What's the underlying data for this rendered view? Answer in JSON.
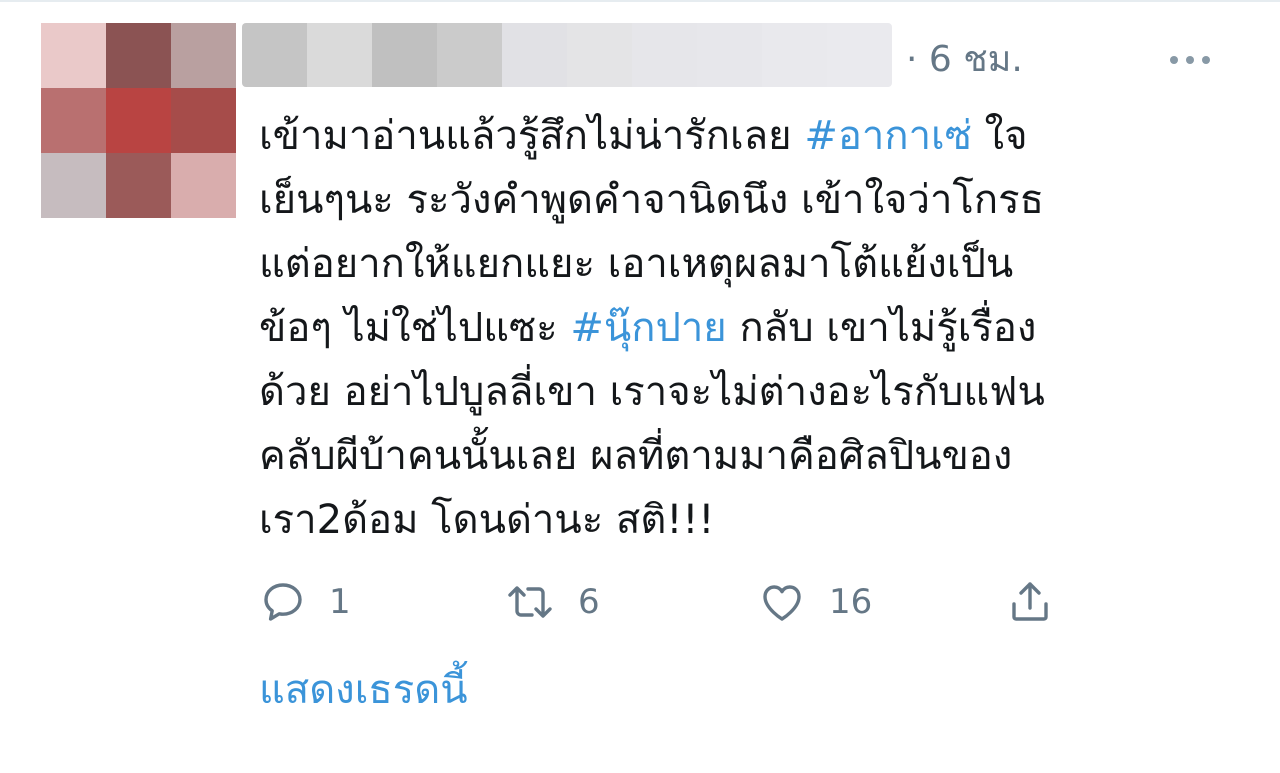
{
  "tweet": {
    "time": "· 6 ชม.",
    "text_lines": [
      [
        {
          "t": "เข้ามาอ่านแล้วรู้สึกไม่น่ารักเลย "
        },
        {
          "t": "#อากาเซ่",
          "h": true
        },
        {
          "t": " ใจ"
        }
      ],
      [
        {
          "t": "เย็นๆนะ ระวังคำพูดคำจานิดนึง เข้าใจว่าโกรธ"
        }
      ],
      [
        {
          "t": "แต่อยากให้แยกแยะ เอาเหตุผลมาโต้แย้งเป็น"
        }
      ],
      [
        {
          "t": "ข้อๆ ไม่ใช่ไปแซะ "
        },
        {
          "t": "#นุ๊กปาย",
          "h": true
        },
        {
          "t": " กลับ เขาไม่รู้เรื่อง"
        }
      ],
      [
        {
          "t": "ด้วย อย่าไปบูลลี่เขา เราจะไม่ต่างอะไรกับแฟน"
        }
      ],
      [
        {
          "t": "คลับผีบ้าคนนั้นเลย ผลที่ตามมาคือศิลปินของ"
        }
      ],
      [
        {
          "t": "เรา2ด้อม โดนด่านะ สติ!!!"
        }
      ]
    ],
    "hashtag_color": "#3b94d9"
  },
  "actions": {
    "reply_count": "1",
    "retweet_count": "6",
    "like_count": "16"
  },
  "show_thread": "แสดงเธรดนี้",
  "avatar_pixels": [
    "#eac9c9",
    "#8b5353",
    "#b9a0a0",
    "#b97070",
    "#b94442",
    "#a64c4a",
    "#c6bcbf",
    "#9b5a59",
    "#d9adad"
  ],
  "namebar_pixels": [
    "#c5c5c5",
    "#dadada",
    "#c0c0c0",
    "#cbcbcb",
    "#e1e1e5",
    "#e4e4e6",
    "#e6e6ea",
    "#e7e7eb",
    "#e9e9ed",
    "#eaeaee"
  ]
}
